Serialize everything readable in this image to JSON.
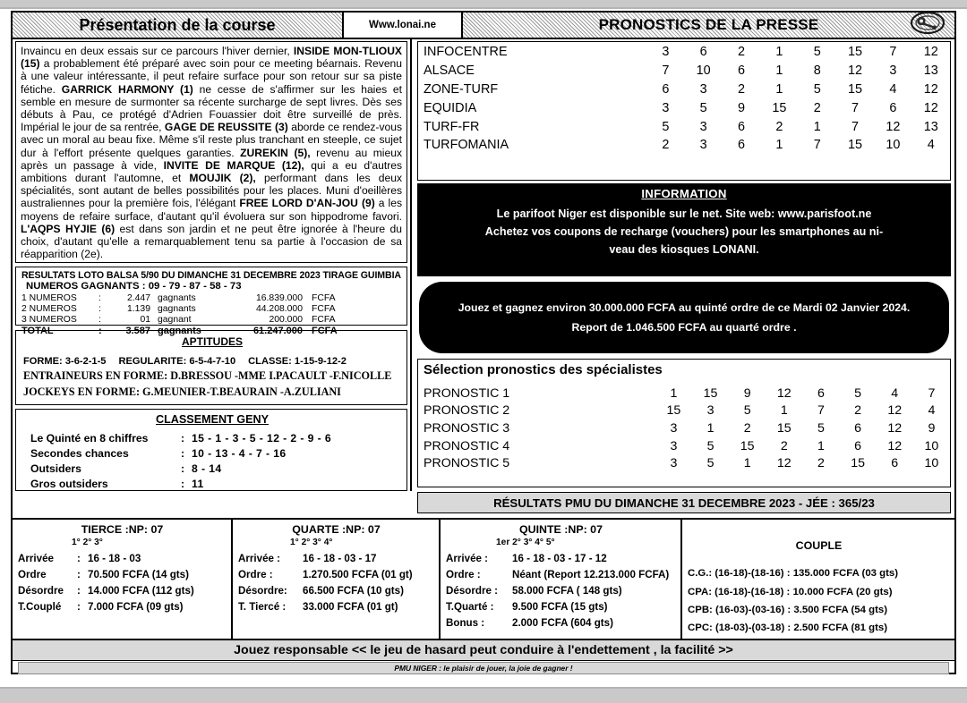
{
  "header": {
    "presentation_title": "Présentation de la course",
    "website": "Www.lonai.ne",
    "press_title": "PRONOSTICS DE LA PRESSE",
    "logo_icon": "lonani-oval-logo"
  },
  "presentation": {
    "paragraph_html": "Invaincu en deux essais sur ce parcours l'hiver dernier, <b>INSIDE MON-TLIOUX (15)</b> a probablement été préparé avec soin pour ce meeting béarnais. Revenu à une valeur intéressante, il peut refaire surface pour son retour sur sa piste fétiche. <b>GARRICK HARMONY (1)</b> ne cesse de s'affirmer sur les haies et semble en mesure de surmonter sa récente surcharge de sept livres. Dès ses débuts à Pau, ce protégé d'Adrien Fouassier doit être surveillé de près. Impérial le jour de sa rentrée, <b>GAGE DE REUSSITE (3)</b> aborde ce rendez-vous avec un moral au beau fixe. Même s'il reste plus tranchant en steeple, ce sujet dur à l'effort présente quelques garanties. <b>ZUREKIN (5),</b> revenu au mieux après un passage à vide, <b>INVITE DE MARQUE (12),</b> qui a eu d'autres ambitions durant l'automne, et <b>MOUJIK (2),</b> performant dans les deux spécialités, sont autant de belles possibilités pour les places. Muni d'oeillères australiennes pour la première fois, l'élégant <b>FREE LORD D'AN-JOU (9)</b> a les moyens de refaire surface, d'autant qu'il évoluera sur son hippodrome favori. <b>L'AQPS HYJIE (6)</b> est dans son jardin et ne peut être ignorée à l'heure du choix, d'autant qu'elle a remarquablement tenu sa partie à l'occasion de sa réapparition (2e)."
  },
  "loto": {
    "title": "RESULTATS LOTO BALSA 5/90 DU DIMANCHE 31 DECEMBRE 2023  TIRAGE GUIMBIA",
    "winning_label": "NUMEROS GAGNANTS",
    "winning_numbers": ": 09 -  79 -  87  -  58  -  73",
    "rows": [
      {
        "label": "1 NUMEROS",
        "colon": ":",
        "count": "2.447",
        "word": "gagnants",
        "amount": "16.839.000",
        "currency": "FCFA"
      },
      {
        "label": "2 NUMEROS",
        "colon": ":",
        "count": "1.139",
        "word": "gagnants",
        "amount": "44.208.000",
        "currency": "FCFA"
      },
      {
        "label": "3 NUMEROS",
        "colon": ":",
        "count": "01",
        "word": "gagnant",
        "amount": "200.000",
        "currency": "FCFA"
      },
      {
        "label": "TOTAL",
        "colon": ":",
        "count": "3.587",
        "word": "gagnants",
        "amount": "61.247.000",
        "currency": "FCFA"
      }
    ]
  },
  "aptitudes": {
    "title": "APTITUDES",
    "forme": "FORME: 3-6-2-1-5",
    "regularite": "REGULARITE: 6-5-4-7-10",
    "classe": "CLASSE: 1-15-9-12-2",
    "entraineurs": "ENTRAINEURS EN FORME: D.BRESSOU -MME I.PACAULT -F.NICOLLE",
    "jockeys": "JOCKEYS EN FORME:  G.MEUNIER-T.BEAURAIN -A.ZULIANI"
  },
  "geny": {
    "title": "CLASSEMENT GENY",
    "rows": [
      {
        "label": "Le Quinté en 8 chiffres",
        "colon": ":",
        "value": "15 -  1 -  3 -  5 -  12  -  2  -  9 -  6"
      },
      {
        "label": "Secondes chances",
        "colon": ":",
        "value": "10 -  13 -  4 -  7 -  16"
      },
      {
        "label": "Outsiders",
        "colon": ":",
        "value": "8  -  14"
      },
      {
        "label": "Gros outsiders",
        "colon": ":",
        "value": "11"
      }
    ]
  },
  "press_table": {
    "rows": [
      {
        "source": "INFOCENTRE",
        "picks": [
          "3",
          "6",
          "2",
          "1",
          "5",
          "15",
          "7",
          "12"
        ]
      },
      {
        "source": "ALSACE",
        "picks": [
          "7",
          "10",
          "6",
          "1",
          "8",
          "12",
          "3",
          "13"
        ]
      },
      {
        "source": "ZONE-TURF",
        "picks": [
          "6",
          "3",
          "2",
          "1",
          "5",
          "15",
          "4",
          "12"
        ]
      },
      {
        "source": "EQUIDIA",
        "picks": [
          "3",
          "5",
          "9",
          "15",
          "2",
          "7",
          "6",
          "12"
        ]
      },
      {
        "source": "TURF-FR",
        "picks": [
          "5",
          "3",
          "6",
          "2",
          "1",
          "7",
          "12",
          "13"
        ]
      },
      {
        "source": "TURFOMANIA",
        "picks": [
          "2",
          "3",
          "6",
          "1",
          "7",
          "15",
          "10",
          "4"
        ]
      }
    ]
  },
  "information": {
    "title": "INFORMATION",
    "line1": "Le parifoot Niger est disponible sur le net. Site web: www.parisfoot.ne",
    "line2": "Achetez vos coupons de recharge (vouchers) pour les smartphones au ni-",
    "line3": "veau des kiosques LONANI."
  },
  "jackpot": {
    "line1": "Jouez et gagnez environ  30.000.000 FCFA au quinté ordre de ce Mardi 02 Janvier 2024.",
    "line2": "Report de 1.046.500 FCFA au quarté ordre ."
  },
  "specialists": {
    "title": "Sélection pronostics des spécialistes",
    "rows": [
      {
        "source": "PRONOSTIC  1",
        "picks": [
          "1",
          "15",
          "9",
          "12",
          "6",
          "5",
          "4",
          "7"
        ]
      },
      {
        "source": "PRONOSTIC  2",
        "picks": [
          "15",
          "3",
          "5",
          "1",
          "7",
          "2",
          "12",
          "4"
        ]
      },
      {
        "source": "PRONOSTIC  3",
        "picks": [
          "3",
          "1",
          "2",
          "15",
          "5",
          "6",
          "12",
          "9"
        ]
      },
      {
        "source": "PRONOSTIC  4",
        "picks": [
          "3",
          "5",
          "15",
          "2",
          "1",
          "6",
          "12",
          "10"
        ]
      },
      {
        "source": "PRONOSTIC  5",
        "picks": [
          "3",
          "5",
          "1",
          "12",
          "2",
          "15",
          "6",
          "10"
        ]
      }
    ]
  },
  "pmu_banner": "RÉSULTATS  PMU  DU DIMANCHE 31 DECEMBRE 2023 - JÉE : 365/23",
  "tierce": {
    "title": "TIERCE :NP: 07",
    "positions": "1°          2°          3°",
    "rows": [
      {
        "label": "Arrivée",
        "colon": ":",
        "value": "16 -  18   -   03"
      },
      {
        "label": "Ordre",
        "colon": ":",
        "value": "70.500   FCFA  (14  gts)"
      },
      {
        "label": "Désordre",
        "colon": ":",
        "value": "14.000   FCFA  (112  gts)"
      },
      {
        "label": "T.Couplé",
        "colon": ":",
        "value": "7.000    FCFA   (09 gts)"
      }
    ]
  },
  "quarte": {
    "title": "QUARTE :NP: 07",
    "positions": "1°        2°       3°      4°",
    "rows": [
      {
        "label": "Arrivée  :",
        "value": "16  -  18  -  03  - 17"
      },
      {
        "label": "Ordre :",
        "value": "1.270.500   FCFA  (01  gt)"
      },
      {
        "label": "Désordre:",
        "value": "66.500    FCFA  (10  gts)"
      },
      {
        "label": "T. Tiercé :",
        "value": "33.000   FCFA  (01 gt)"
      }
    ]
  },
  "quinte": {
    "title": "QUINTE :NP: 07",
    "positions": "1er    2°      3°     4°    5°",
    "rows": [
      {
        "label": "Arrivée :",
        "value": "16  -  18  -  03  -  17 - 12"
      },
      {
        "label": "Ordre  :",
        "value": "Néant (Report 12.213.000  FCFA)"
      },
      {
        "label": "Désordre :",
        "value": "58.000   FCFA  ( 148  gts)"
      },
      {
        "label": "T.Quarté  :",
        "value": "9.500    FCFA  (15  gts)"
      },
      {
        "label": "Bonus      :",
        "value": "2.000   FCFA  (604 gts)"
      }
    ]
  },
  "couple": {
    "title": "COUPLE",
    "rows": [
      {
        "text": "C.G.: (16-18)-(18-16) : 135.000 FCFA  (03  gts)"
      },
      {
        "text": "CPA: (16-18)-(16-18) :  10.000  FCFA  (20  gts)"
      },
      {
        "text": "CPB: (16-03)-(03-16) :   3.500   FCFA  (54  gts)"
      },
      {
        "text": "CPC: (18-03)-(03-18) :   2.500   FCFA  (81  gts)"
      }
    ]
  },
  "footer": {
    "responsible": "Jouez responsable << le jeu de hasard peut conduire à l'endettement , la facilité >>",
    "tagline": "PMU NIGER : le plaisir de jouer, la joie de gagner !"
  }
}
